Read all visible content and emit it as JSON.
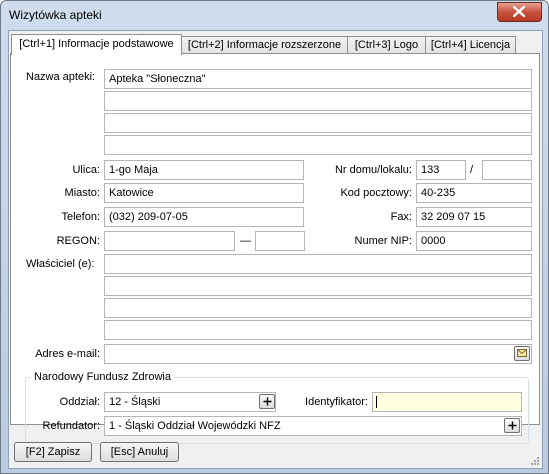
{
  "window": {
    "title": "Wizytówka apteki"
  },
  "tabs": [
    {
      "label": "[Ctrl+1] Informacje podstawowe"
    },
    {
      "label": "[Ctrl+2] Informacje rozszerzone"
    },
    {
      "label": "[Ctrl+3] Logo"
    },
    {
      "label": "[Ctrl+4] Licencja"
    }
  ],
  "form": {
    "name_label": "Nazwa apteki:",
    "name_lines": [
      "Apteka \"Słoneczna\"",
      "",
      "",
      ""
    ],
    "street_label": "Ulica:",
    "street": "1-go Maja",
    "house_label": "Nr domu/lokalu:",
    "house": "133",
    "house_sep": "/",
    "flat": "",
    "city_label": "Miasto:",
    "city": "Katowice",
    "zip_label": "Kod pocztowy:",
    "zip": "40-235",
    "phone_label": "Telefon:",
    "phone": "(032) 209-07-05",
    "fax_label": "Fax:",
    "fax": "32 209 07 15",
    "regon_label": "REGON:",
    "regon_1": "",
    "regon_sep": "—",
    "regon_2": "",
    "nip_label": "Numer NIP:",
    "nip": "0000",
    "owner_label": "Właściciel (e):",
    "owner_lines": [
      "",
      "",
      "",
      ""
    ],
    "email_label": "Adres e-mail:",
    "email": "",
    "email_icon": "envelope-icon"
  },
  "nfz": {
    "group_title": "Narodowy Fundusz Zdrowia",
    "branch_label": "Oddział:",
    "branch": "12 - Śląski",
    "id_label": "Identyfikator:",
    "id": "",
    "refunder_label": "Refundator:",
    "refunder": "1 - Śląski Oddział Wojewódzki NFZ",
    "picker_icon": "plus-icon"
  },
  "footer": {
    "save_label": "[F2] Zapisz",
    "cancel_label": "[Esc] Anuluj"
  },
  "colors": {
    "highlight_field": "#ffffe0",
    "close_button": "#c9523c"
  }
}
